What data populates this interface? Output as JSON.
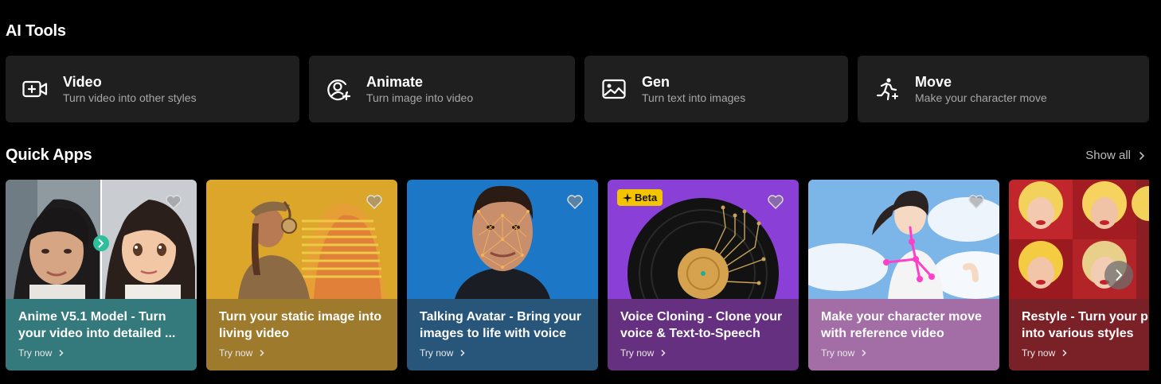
{
  "ai_tools": {
    "title": "AI Tools",
    "items": [
      {
        "title": "Video",
        "desc": "Turn video into other styles",
        "icon": "video-plus-icon"
      },
      {
        "title": "Animate",
        "desc": "Turn image into video",
        "icon": "animate-person-icon"
      },
      {
        "title": "Gen",
        "desc": "Turn text into images",
        "icon": "image-icon"
      },
      {
        "title": "Move",
        "desc": "Make your character move",
        "icon": "running-person-icon"
      }
    ]
  },
  "quick_apps": {
    "title": "Quick Apps",
    "show_all": "Show all",
    "cards": [
      {
        "title_line1": "Anime V5.1 Model - Turn",
        "title_line2": "your video into detailed ...",
        "cta": "Try now",
        "info_color": "#347a7c",
        "art_icon": "anime-portrait-comparison-image"
      },
      {
        "title_line1": "Turn your static image into",
        "title_line2": "living video",
        "cta": "Try now",
        "info_color": "#9d7a2c",
        "art_icon": "woman-headphones-image"
      },
      {
        "title_line1": "Talking Avatar - Bring your",
        "title_line2": "images to life with voice",
        "cta": "Try now",
        "info_color": "#27567a",
        "art_icon": "face-mesh-image"
      },
      {
        "title_line1": "Voice Cloning - Clone your",
        "title_line2": "voice & Text-to-Speech",
        "cta": "Try now",
        "info_color": "#64307f",
        "badge": "Beta",
        "art_icon": "vinyl-record-image"
      },
      {
        "title_line1": "Make your character move",
        "title_line2": "with reference video",
        "cta": "Try now",
        "info_color": "#a36ea6",
        "art_icon": "anime-runner-pose-image"
      },
      {
        "title_line1": "Restyle - Turn your photo",
        "title_line2": "into various styles",
        "cta": "Try now",
        "info_color": "#7a2128",
        "art_icon": "pop-art-grid-image"
      }
    ]
  },
  "colors": {
    "background": "#000000",
    "tool_card": "#1f1f1f",
    "beta_badge": "#f5c400"
  }
}
